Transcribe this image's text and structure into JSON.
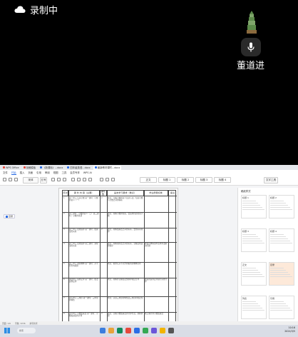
{
  "recording": {
    "label": "录制中"
  },
  "presenter": {
    "name": "董道进"
  },
  "app": {
    "tabs": [
      {
        "label": "WPS Office",
        "color": "#e5483d"
      },
      {
        "label": "找稿模板",
        "color": "#e5483d"
      },
      {
        "label": "《新课标》...docx",
        "color": "#2b6de5"
      },
      {
        "label": "四年级英语...docx",
        "color": "#2b6de5"
      },
      {
        "label": "最新教材课时...docx",
        "color": "#2b6de5"
      }
    ],
    "menus": [
      "文件",
      "开始",
      "插入",
      "页面",
      "引用",
      "审阅",
      "视图",
      "工具",
      "会员专享",
      "WPS AI"
    ],
    "active_menu": "开始",
    "styles": [
      "正文",
      "标题 1",
      "标题 2",
      "标题 3",
      "标题 4"
    ],
    "style_set_label": "文字工具",
    "left_button": "目录",
    "table": {
      "headers": [
        "周次",
        "课 时 内 容（主要）",
        "课时数",
        "基本学习要求（重点）",
        "学业质量标准",
        "备注"
      ],
      "rows": [
        {
          "week": "1",
          "content": "第一单元 认识小数 第一课时：小数的意义（一）",
          "hours": "2",
          "req": "重点：掌握小数的意义及读写法，知道小数与分数之间的联系",
          "std": ""
        },
        {
          "week": "2",
          "content": "第二课时：小数的意义（二）第三课时：小数的性质",
          "hours": "",
          "req": "重点：理解小数的性质，会运用性质化简小数",
          "std": ""
        },
        {
          "week": "3",
          "content": "第二单元 四则运算 第一课时：加减法的关系",
          "hours": "2",
          "req": "重点：理解加减法之间的关系，会用关系验算",
          "std": ""
        },
        {
          "week": "4",
          "content": "第二单元 四则运算 第二课时：乘除法的关系",
          "hours": "",
          "req": "重点：理解乘除法之间的关系，掌握四则运算顺序",
          "std": "能在具体情境中选择算法解决问题"
        },
        {
          "week": "5",
          "content": "第三单元 观察物体 第一课时：从不同方向观察",
          "hours": "",
          "req": "重点：能辨认从不同方向看到的物体形状",
          "std": ""
        },
        {
          "week": "6",
          "content": "第四单元 运算定律 第一课时：加法运算定律",
          "hours": "",
          "req": "重点：理解并掌握加法交换律和结合律",
          "std": "能运用运算定律进行简便计算"
        },
        {
          "week": "7",
          "content": "第五单元 三角形 第一课时：三角形的特性",
          "hours": "",
          "req": "重点：认识三角形的特性及三角形的稳定性",
          "std": ""
        },
        {
          "week": "8",
          "content": "第六单元 小数加减法 第一课时：小数加减法的计算",
          "hours": "2",
          "req": "重点：掌握小数加减法的计算方法，理解算理",
          "std": "能正确计算小数加减法"
        }
      ]
    },
    "panel": {
      "title": "稿纸样式",
      "cards": [
        "标题 1",
        "标题 2",
        "标题 3",
        "标题 4",
        "正文",
        "目录",
        "列表",
        "引用"
      ]
    },
    "status": {
      "page": "页面: 1/6",
      "words": "字数: 3236",
      "spell": "拼写检查"
    },
    "taskbar": {
      "search": "搜索",
      "time": "10:16",
      "date": "2024/3/5"
    }
  }
}
